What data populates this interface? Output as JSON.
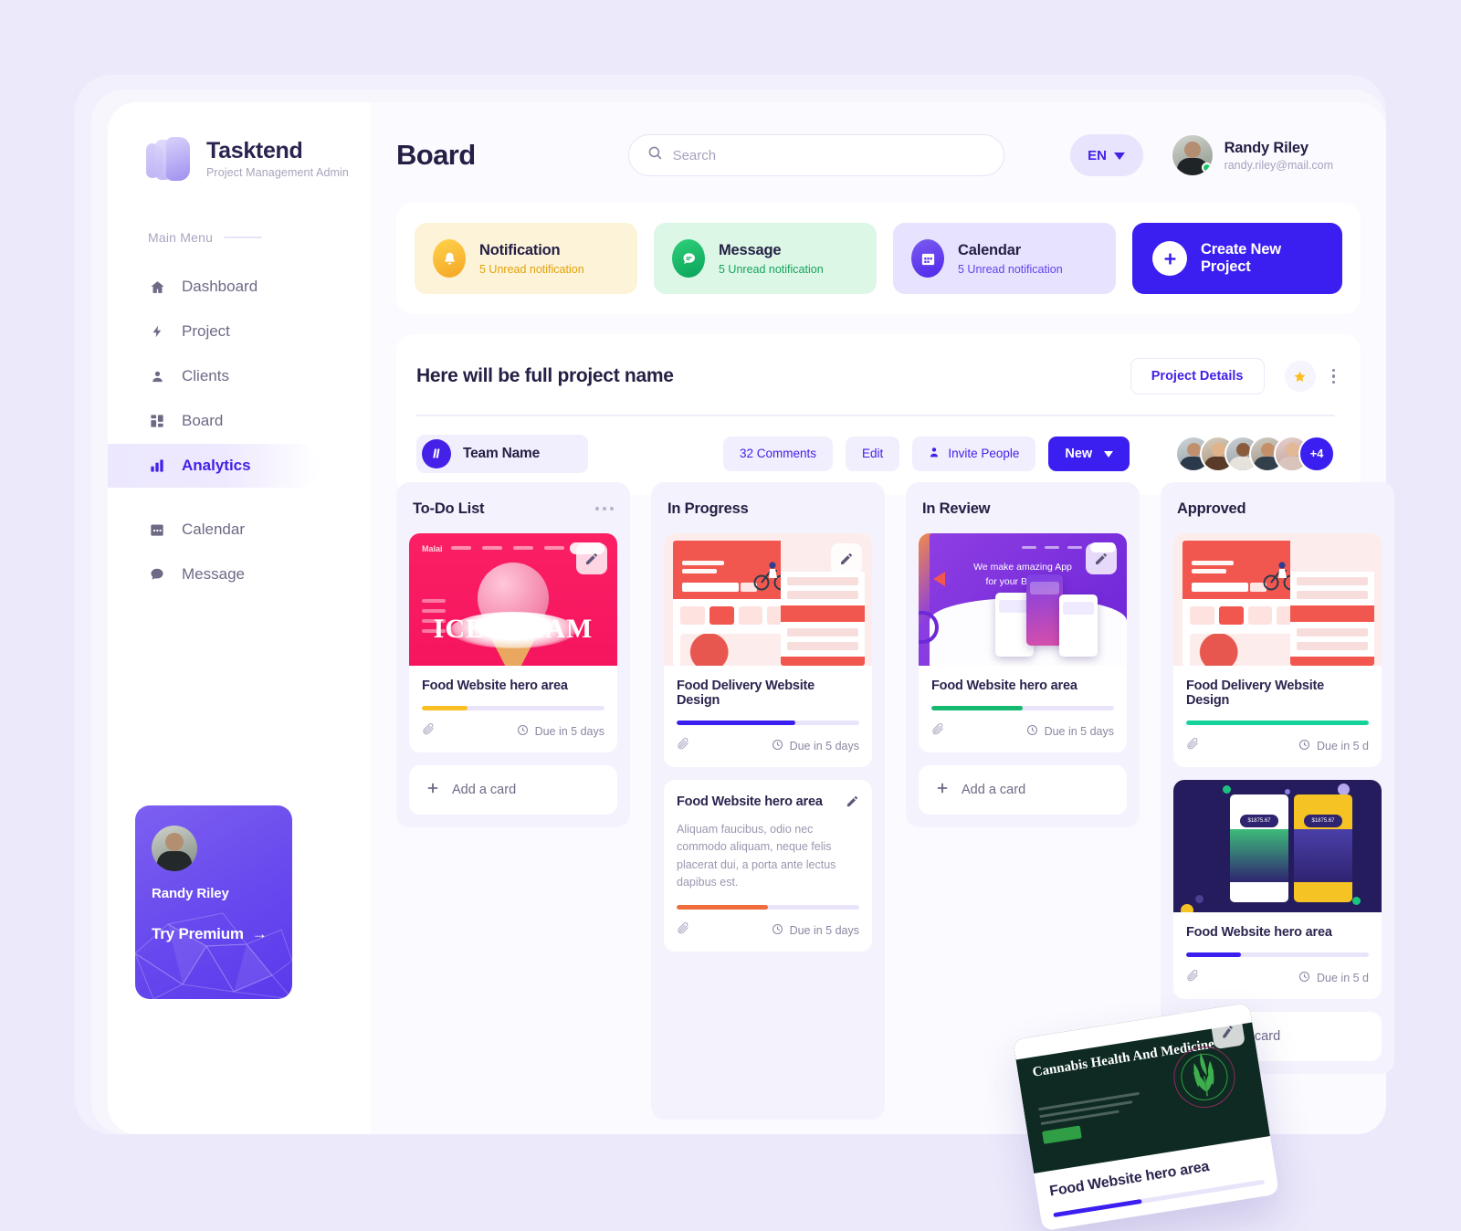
{
  "sidebar": {
    "brand": {
      "name": "Tasktend",
      "subtitle": "Project Management Admin",
      "logo_icon": "layers-logo-icon"
    },
    "menu_label": "Main Menu",
    "items": [
      {
        "label": "Dashboard",
        "icon": "home-icon",
        "active": false
      },
      {
        "label": "Project",
        "icon": "bolt-icon",
        "active": false
      },
      {
        "label": "Clients",
        "icon": "user-icon",
        "active": false
      },
      {
        "label": "Board",
        "icon": "grid-icon",
        "active": false
      },
      {
        "label": "Analytics",
        "icon": "bar-chart-icon",
        "active": true
      },
      {
        "label": "Calendar",
        "icon": "calendar-icon",
        "active": false
      },
      {
        "label": "Message",
        "icon": "chat-icon",
        "active": false
      }
    ],
    "promo": {
      "name": "Randy Riley",
      "cta": "Try Premium",
      "arrow": "→",
      "avatar": "user-avatar"
    }
  },
  "header": {
    "title": "Board",
    "search": {
      "placeholder": "Search",
      "value": "",
      "icon": "search-icon"
    },
    "language": {
      "value": "EN",
      "caret": "chevron-down-icon"
    },
    "profile": {
      "name": "Randy Riley",
      "email": "randy.riley@mail.com",
      "status": "online"
    }
  },
  "status_cards": [
    {
      "title": "Notification",
      "subtitle": "5 Unread notification",
      "icon": "bell-icon",
      "color": "#f5a623",
      "bg": "#fdf3d9"
    },
    {
      "title": "Message",
      "subtitle": "5 Unread notification",
      "icon": "chat-icon",
      "color": "#0aa35a",
      "bg": "#dcf7e6"
    },
    {
      "title": "Calendar",
      "subtitle": "5 Unread notification",
      "icon": "calendar-icon",
      "color": "#4f27ea",
      "bg": "#e7e2fd"
    }
  ],
  "create_project": {
    "label": "Create New Project",
    "icon": "plus-icon",
    "color": "#3b1ef0"
  },
  "project": {
    "name": "Here will be full project name",
    "details_label": "Project Details",
    "star_icon": "star-icon",
    "more_icon": "more-vertical-icon",
    "team_label": "Team Name",
    "team_icon": "team-badge-icon",
    "comments_label": "32 Comments",
    "edit_label": "Edit",
    "invite_label": "Invite People",
    "invite_icon": "person-add-icon",
    "new_label": "New",
    "new_caret": "chevron-down-icon",
    "avatars_more": "+4"
  },
  "board": {
    "add_card_label": "Add a card",
    "add_card_icon": "plus-icon",
    "due_icon": "clock-icon",
    "attachment_icon": "paperclip-icon",
    "edit_icon": "pencil-icon",
    "columns": [
      {
        "title": "To-Do List",
        "menu_icon": "more-horizontal-icon",
        "has_menu": true,
        "has_add_card": true,
        "cards": [
          {
            "art": "icecream",
            "title": "Food Website hero area",
            "progress": 25,
            "progress_color": "#fbbf24",
            "due": "Due in 5 days",
            "has_edit_badge": true
          }
        ]
      },
      {
        "title": "In Progress",
        "has_menu": false,
        "has_add_card": false,
        "cards": [
          {
            "art": "food-delivery",
            "title": "Food Delivery Website Design",
            "progress": 65,
            "progress_color": "#3b1ef0",
            "due": "Due in 5 days",
            "has_edit_badge": true
          },
          {
            "art": "none",
            "title": "Food Website hero area",
            "description": "Aliquam faucibus, odio nec commodo aliquam, neque felis placerat dui, a porta ante lectus dapibus est.",
            "progress": 50,
            "progress_color": "#ef6c3b",
            "due": "Due in 5 days",
            "has_edit_badge": true
          }
        ]
      },
      {
        "title": "In Review",
        "has_menu": false,
        "has_add_card": true,
        "cards": [
          {
            "art": "app-review",
            "title": "Food Website hero area",
            "progress": 50,
            "progress_color": "#14b86e",
            "due": "Due in 5 days",
            "has_edit_badge": true
          }
        ]
      },
      {
        "title": "Approved",
        "has_menu": false,
        "has_add_card": true,
        "cards": [
          {
            "art": "food-delivery",
            "title": "Food Delivery Website Design",
            "progress": 100,
            "progress_color": "#14d39a",
            "due": "Due in 5 d",
            "has_edit_badge": false
          },
          {
            "art": "dark-dashboard",
            "title": "Food Website hero area",
            "progress": 30,
            "progress_color": "#3b1ef0",
            "due": "Due in 5 d",
            "has_edit_badge": false
          }
        ]
      }
    ],
    "dragged_card": {
      "art": "cannabis",
      "hero_title": "Cannabis Health And Medicine",
      "title": "Food Website hero area",
      "progress": 42,
      "progress_color": "#3b1ef0",
      "has_edit_badge": true
    }
  }
}
